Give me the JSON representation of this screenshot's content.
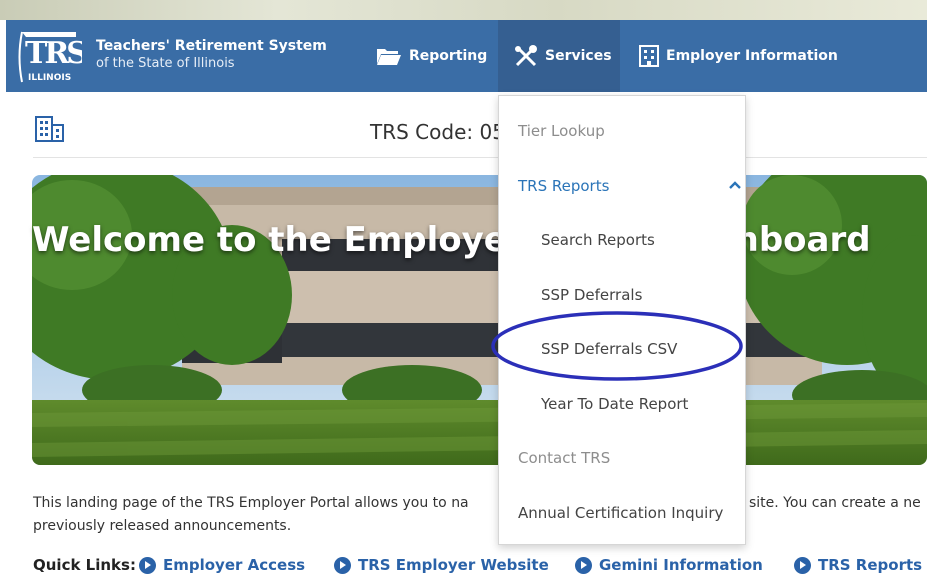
{
  "header": {
    "org_line1": "Teachers' Retirement System",
    "org_line2": "of the State of Illinois",
    "logo_text": "TRS",
    "logo_sub": "ILLINOIS"
  },
  "nav": {
    "reporting": "Reporting",
    "services": "Services",
    "employer_info": "Employer Information"
  },
  "page": {
    "trs_code": "TRS Code: 05"
  },
  "hero": {
    "title": "Welcome to the Employer Portal Dashboard"
  },
  "intro": {
    "line1_left": "This landing page of the TRS Employer Portal allows you to na",
    "line1_right": "site. You can create a ne",
    "line2": "previously released announcements."
  },
  "quick_links": {
    "label": "Quick Links:",
    "items": [
      "Employer Access",
      "TRS Employer Website",
      "Gemini Information",
      "TRS Reports"
    ]
  },
  "services_menu": {
    "tier_lookup": "Tier Lookup",
    "trs_reports": "TRS Reports",
    "search_reports": "Search Reports",
    "ssp_deferrals": "SSP Deferrals",
    "ssp_deferrals_csv": "SSP Deferrals CSV",
    "ytd_report": "Year To Date Report",
    "contact_trs": "Contact TRS",
    "annual_cert": "Annual Certification Inquiry"
  },
  "colors": {
    "navbar": "#3a6da6",
    "link_blue": "#2a62a8",
    "menu_header_blue": "#2a74b8",
    "annotation_circle": "#2b2fb8"
  }
}
